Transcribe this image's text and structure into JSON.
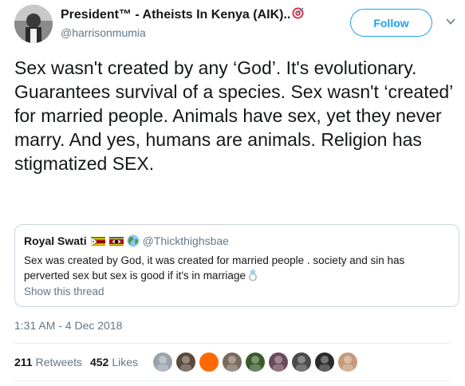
{
  "tweet": {
    "author_name": "President™ - Atheists In Kenya (AIK)..",
    "author_handle": "@harrisonmumia",
    "follow_label": "Follow",
    "text": "Sex wasn't created by any ‘God’. It's evolutionary.  Guarantees survival of a species. Sex wasn't ‘created’ for married people. Animals have sex, yet they never marry. And yes, humans are animals. Religion has stigmatized SEX.",
    "timestamp": "1:31 AM - 4 Dec 2018",
    "retweets_count": "211",
    "retweets_label": "Retweets",
    "likes_count": "452",
    "likes_label": "Likes"
  },
  "quote": {
    "author_name": "Royal Swati",
    "author_handle": "@Thickthighsbae",
    "text": "Sex was created by God, it was created for married people . society and sin has perverted sex but sex is good if it's in marriage",
    "show_thread_label": "Show this thread"
  },
  "icons": [
    "dartboard-emoji",
    "chevron-down-icon",
    "zimbabwe-flag",
    "eswatini-flag",
    "earth-emoji",
    "ring-emoji"
  ],
  "colors": {
    "accent": "#1da1f2",
    "secondary_text": "#657786",
    "primary_text": "#14171a",
    "border": "#ccd6dd"
  },
  "likers": [
    {
      "bg": "#9aa3ad"
    },
    {
      "bg": "#5a4a3a"
    },
    {
      "bg": "#ff6a00"
    },
    {
      "bg": "#7a6a5a"
    },
    {
      "bg": "#3a5a2a"
    },
    {
      "bg": "#6a4a5a"
    },
    {
      "bg": "#4a4a4a"
    },
    {
      "bg": "#2a2a2a"
    },
    {
      "bg": "#c49a7a"
    }
  ]
}
